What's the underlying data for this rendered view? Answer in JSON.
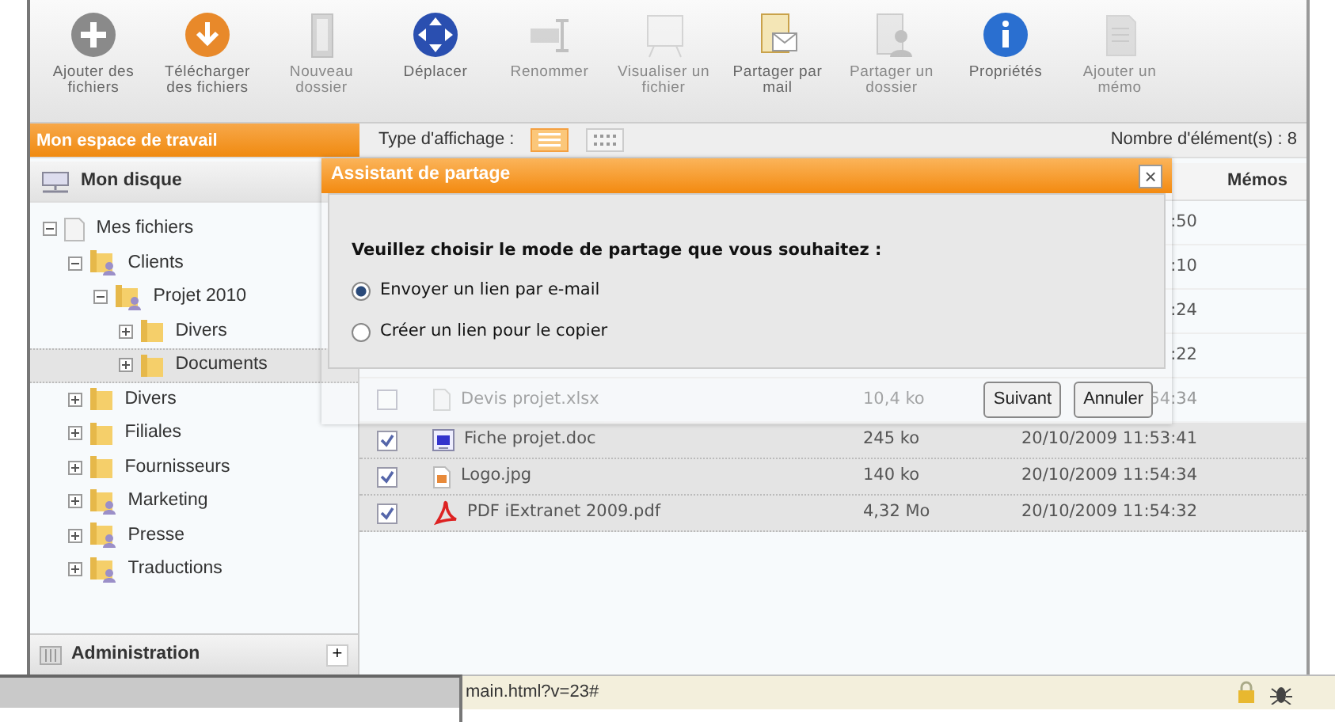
{
  "toolbar": [
    {
      "kind": "add",
      "label": "Ajouter des\nfichiers",
      "disabled": false
    },
    {
      "kind": "download",
      "label": "Télécharger\ndes fichiers",
      "disabled": false
    },
    {
      "kind": "folder",
      "label": "Nouveau\ndossier",
      "disabled": true
    },
    {
      "kind": "move",
      "label": "Déplacer",
      "disabled": false
    },
    {
      "kind": "rename",
      "label": "Renommer",
      "disabled": true
    },
    {
      "kind": "view",
      "label": "Visualiser un\nfichier",
      "disabled": true
    },
    {
      "kind": "share_mail",
      "label": "Partager par\nmail",
      "disabled": false
    },
    {
      "kind": "share_folder",
      "label": "Partager un\ndossier",
      "disabled": true
    },
    {
      "kind": "info",
      "label": "Propriétés",
      "disabled": false
    },
    {
      "kind": "memo",
      "label": "Ajouter un\nmémo",
      "disabled": true
    }
  ],
  "workspace_title": "Mon espace de travail",
  "view_bar": {
    "label": "Type d'affichage :",
    "views": [
      {
        "kind": "list",
        "selected": true
      },
      {
        "kind": "grid",
        "selected": false
      }
    ],
    "count": "Nombre d'élément(s) : 8"
  },
  "sidebar": {
    "title": "Mon disque",
    "tree": [
      {
        "label": "Mes fichiers",
        "kind": "root",
        "expanded": true,
        "selected": false,
        "children": [
          {
            "label": "Clients",
            "kind": "shared",
            "expanded": true,
            "selected": false,
            "children": [
              {
                "label": "Projet 2010",
                "kind": "shared",
                "expanded": true,
                "selected": false,
                "children": [
                  {
                    "label": "Divers",
                    "kind": "folder",
                    "expanded": false,
                    "selected": false
                  },
                  {
                    "label": "Documents",
                    "kind": "folder",
                    "expanded": false,
                    "selected": true
                  }
                ]
              }
            ]
          },
          {
            "label": "Divers",
            "kind": "folder",
            "expanded": false,
            "selected": false
          },
          {
            "label": "Filiales",
            "kind": "folder",
            "expanded": false,
            "selected": false
          },
          {
            "label": "Fournisseurs",
            "kind": "folder",
            "expanded": false,
            "selected": false
          },
          {
            "label": "Marketing",
            "kind": "shared",
            "expanded": false,
            "selected": false
          },
          {
            "label": "Presse",
            "kind": "shared",
            "expanded": false,
            "selected": false
          },
          {
            "label": "Traductions",
            "kind": "shared",
            "expanded": false,
            "selected": false
          }
        ]
      }
    ],
    "footer": "Administration",
    "footer_button": "+"
  },
  "table": {
    "memos_header": "Mémos",
    "rows": [
      {
        "date": ":50"
      },
      {
        "date": ":10"
      },
      {
        "date": ":24"
      },
      {
        "date": ":22"
      },
      {
        "kind": "xlsx",
        "name": "Devis projet.xlsx",
        "size": "10,4 ko",
        "date": "54:34",
        "checked": false,
        "selected": false,
        "dimmed": true
      },
      {
        "kind": "doc",
        "name": "Fiche projet.doc",
        "size": "245 ko",
        "date": "20/10/2009 11:53:41",
        "checked": true,
        "selected": true
      },
      {
        "kind": "image",
        "name": "Logo.jpg",
        "size": "140 ko",
        "date": "20/10/2009 11:54:34",
        "checked": true,
        "selected": true
      },
      {
        "kind": "pdf",
        "name": "PDF iExtranet 2009.pdf",
        "size": "4,32 Mo",
        "date": "20/10/2009 11:54:32",
        "checked": true,
        "selected": true
      }
    ]
  },
  "dialog": {
    "title": "Assistant de partage",
    "close": "×",
    "prompt": "Veuillez choisir le mode de partage que vous souhaitez :",
    "options": [
      {
        "label": "Envoyer un lien par e-mail",
        "selected": true
      },
      {
        "label": "Créer un lien pour le copier",
        "selected": false
      }
    ],
    "buttons": [
      "Suivant",
      "Annuler"
    ]
  },
  "status_bar": {
    "url": "main.html?v=23#"
  }
}
